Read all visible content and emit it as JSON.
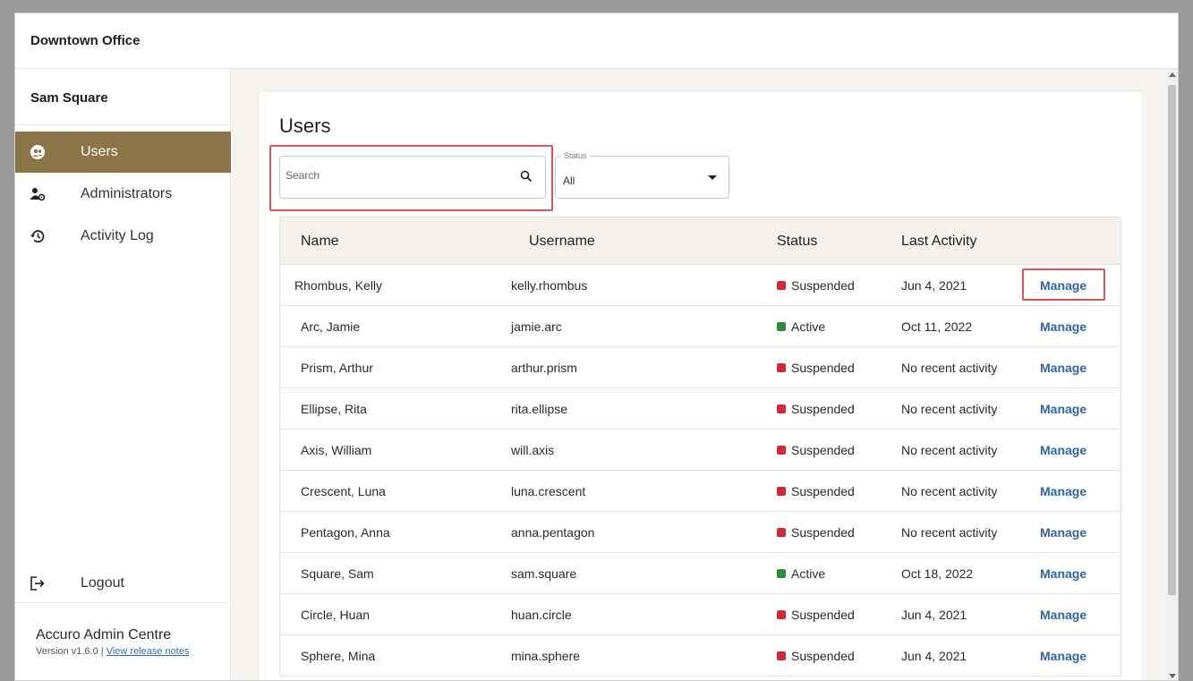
{
  "header": {
    "title": "Downtown Office"
  },
  "sidebar": {
    "user_name": "Sam Square",
    "items": [
      {
        "label": "Users",
        "icon": "users-icon",
        "active": true
      },
      {
        "label": "Administrators",
        "icon": "admin-gear-icon",
        "active": false
      },
      {
        "label": "Activity Log",
        "icon": "history-icon",
        "active": false
      }
    ],
    "logout_label": "Logout",
    "app_name": "Accuro Admin Centre",
    "version": "Version v1.6.0",
    "release_notes_link": "View release notes"
  },
  "main": {
    "heading": "Users",
    "search": {
      "placeholder": "Search",
      "value": ""
    },
    "status_filter": {
      "label": "Status",
      "value": "All"
    },
    "columns": [
      "Name",
      "Username",
      "Status",
      "Last Activity"
    ],
    "manage_label": "Manage",
    "rows": [
      {
        "name": "Rhombus, Kelly",
        "username": "kelly.rhombus",
        "status": "Suspended",
        "last_activity": "Jun 4, 2021"
      },
      {
        "name": "Arc, Jamie",
        "username": "jamie.arc",
        "status": "Active",
        "last_activity": "Oct 11, 2022"
      },
      {
        "name": "Prism, Arthur",
        "username": "arthur.prism",
        "status": "Suspended",
        "last_activity": "No recent activity"
      },
      {
        "name": "Ellipse, Rita",
        "username": "rita.ellipse",
        "status": "Suspended",
        "last_activity": "No recent activity"
      },
      {
        "name": "Axis, William",
        "username": "will.axis",
        "status": "Suspended",
        "last_activity": "No recent activity"
      },
      {
        "name": "Crescent, Luna",
        "username": "luna.crescent",
        "status": "Suspended",
        "last_activity": "No recent activity"
      },
      {
        "name": "Pentagon, Anna",
        "username": "anna.pentagon",
        "status": "Suspended",
        "last_activity": "No recent activity"
      },
      {
        "name": "Square, Sam",
        "username": "sam.square",
        "status": "Active",
        "last_activity": "Oct 18, 2022"
      },
      {
        "name": "Circle, Huan",
        "username": "huan.circle",
        "status": "Suspended",
        "last_activity": "Jun 4, 2021"
      },
      {
        "name": "Sphere, Mina",
        "username": "mina.sphere",
        "status": "Suspended",
        "last_activity": "Jun 4, 2021"
      }
    ]
  },
  "colors": {
    "accent": "#8b7547",
    "active_status": "#2e8b3e",
    "suspended_status": "#d0293b",
    "link": "#2e64a8",
    "highlight": "#e25454"
  }
}
